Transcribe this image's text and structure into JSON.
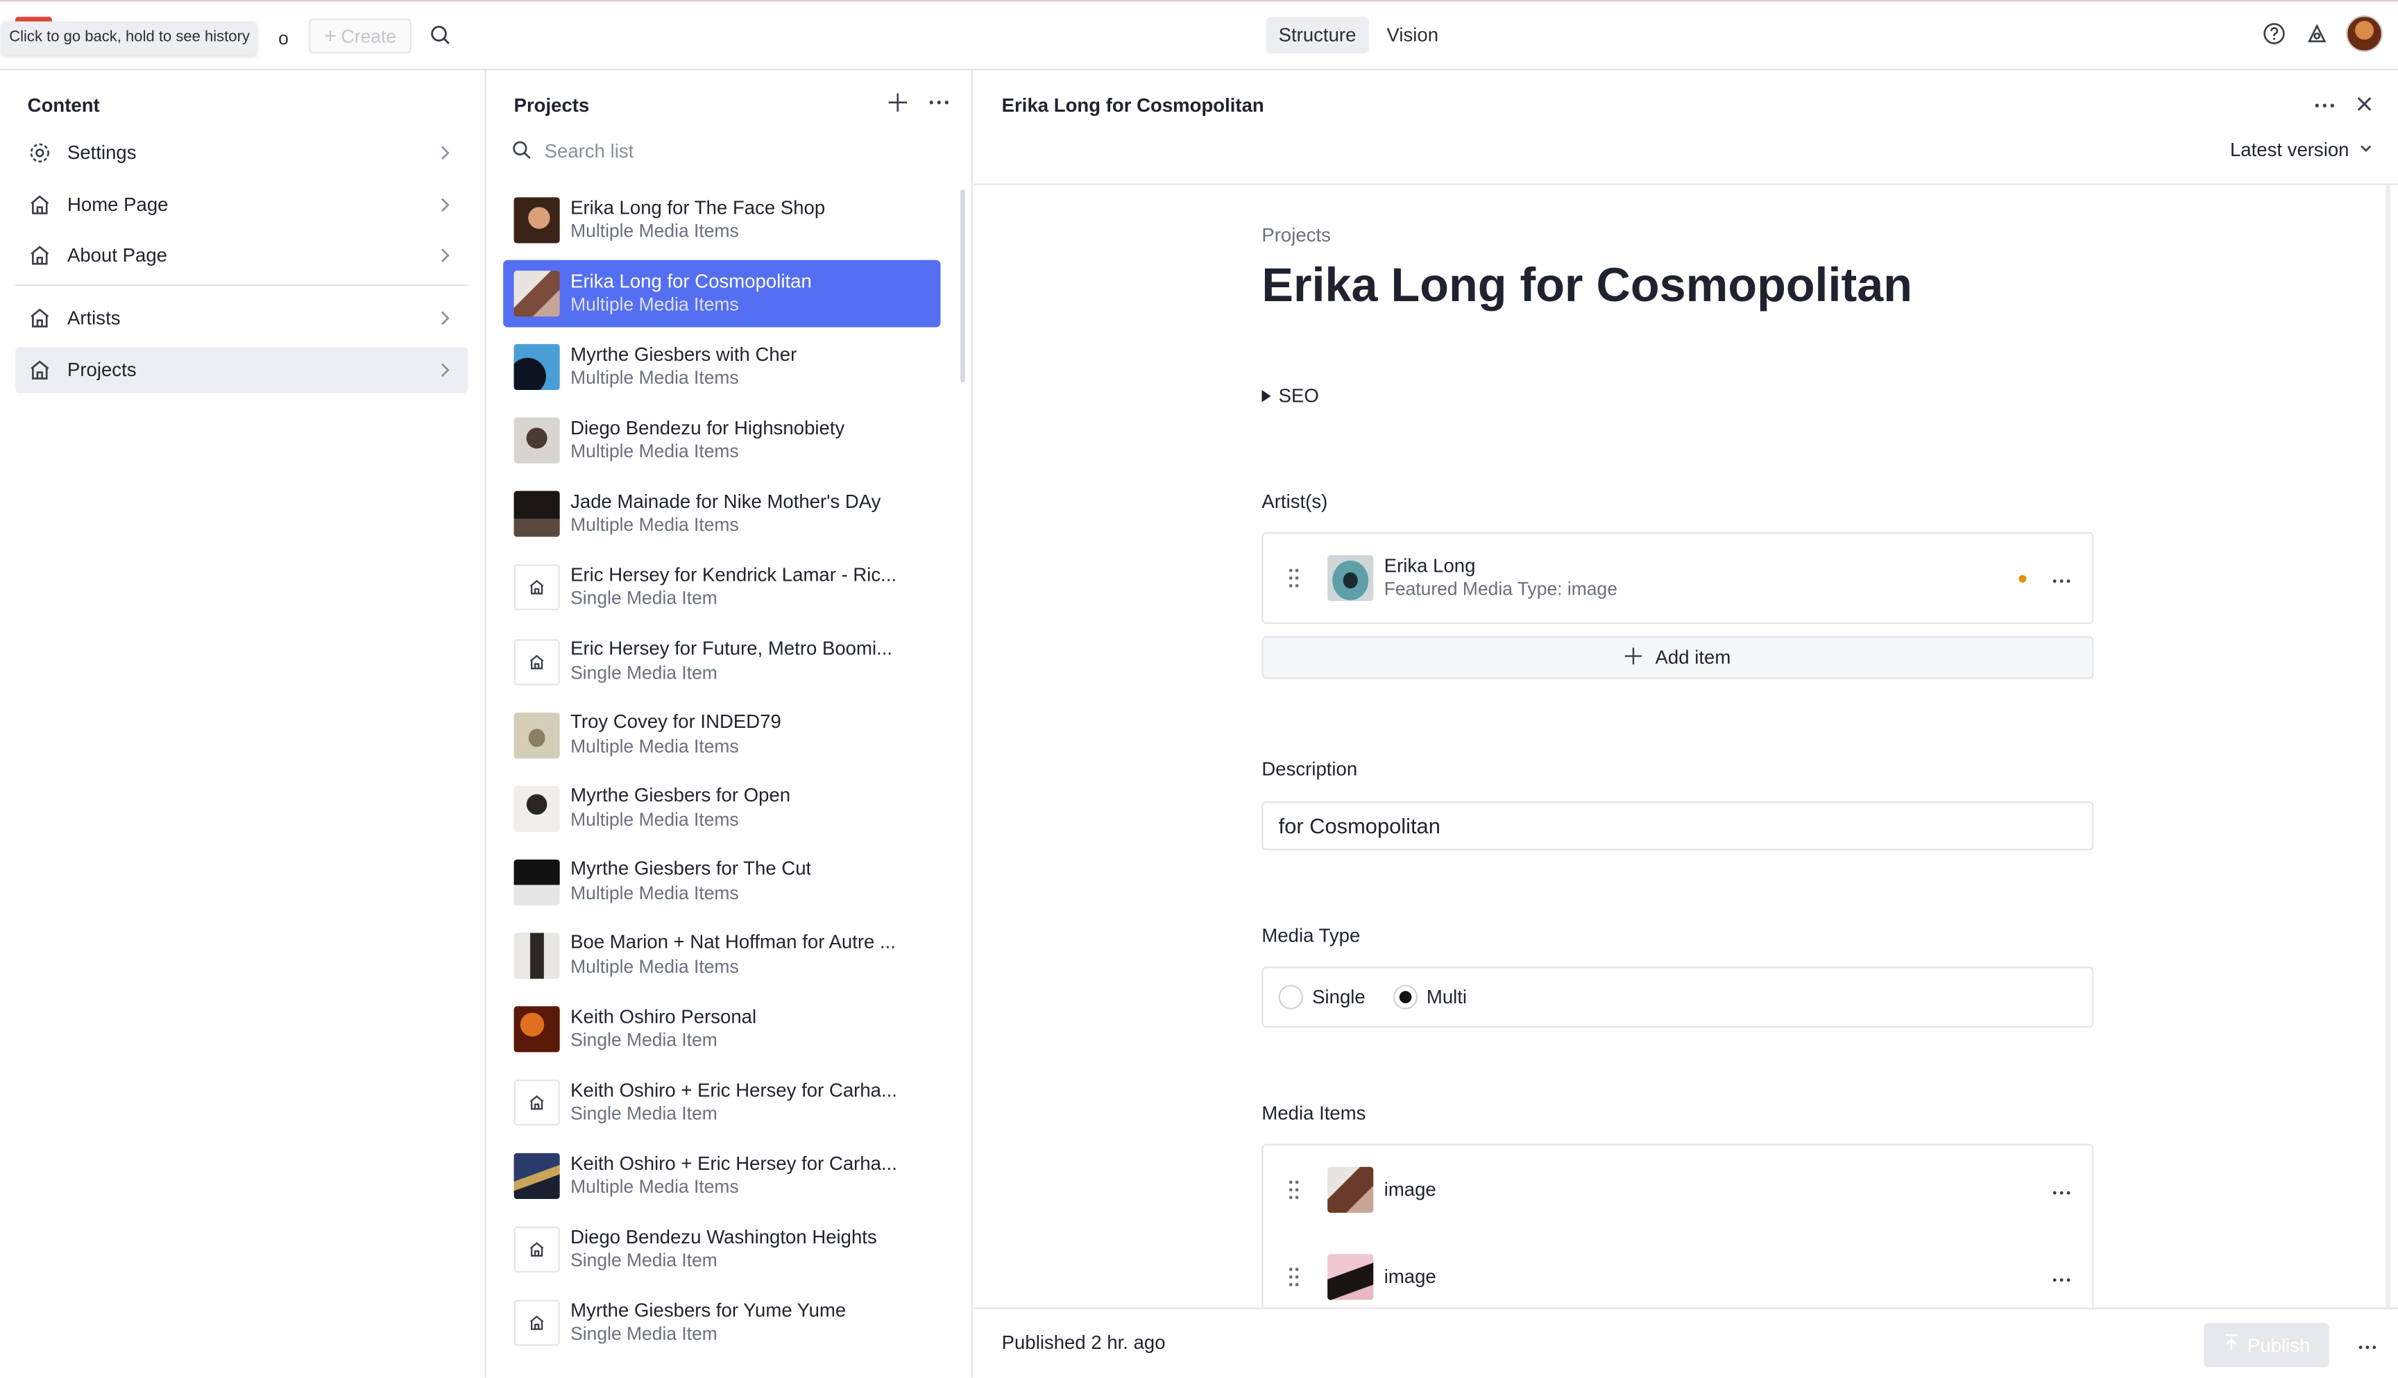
{
  "topbar": {
    "tooltip": "Click to go back, hold to see history",
    "tooltip_tail": "o",
    "create_label": "Create",
    "modes": [
      "Structure",
      "Vision"
    ],
    "active_mode": "Structure"
  },
  "content_pane": {
    "title": "Content",
    "items": [
      {
        "label": "Settings",
        "icon": "gear-icon"
      },
      {
        "label": "Home Page",
        "icon": "home-icon"
      },
      {
        "label": "About Page",
        "icon": "home-icon"
      },
      {
        "label": "Artists",
        "icon": "home-icon"
      },
      {
        "label": "Projects",
        "icon": "home-icon"
      }
    ],
    "active": "Projects"
  },
  "projects_pane": {
    "title": "Projects",
    "search_placeholder": "Search list",
    "items": [
      {
        "title": "Erika Long for The Face Shop",
        "subtitle": "Multiple Media Items"
      },
      {
        "title": "Erika Long for Cosmopolitan",
        "subtitle": "Multiple Media Items"
      },
      {
        "title": "Myrthe Giesbers with Cher",
        "subtitle": "Multiple Media Items"
      },
      {
        "title": "Diego Bendezu for Highsnobiety",
        "subtitle": "Multiple Media Items"
      },
      {
        "title": "Jade Mainade for Nike Mother's DAy",
        "subtitle": "Multiple Media Items"
      },
      {
        "title": "Eric Hersey for Kendrick Lamar - Ric...",
        "subtitle": "Single Media Item"
      },
      {
        "title": "Eric Hersey for Future, Metro Boomi...",
        "subtitle": "Single Media Item"
      },
      {
        "title": "Troy Covey for INDED79",
        "subtitle": "Multiple Media Items"
      },
      {
        "title": "Myrthe Giesbers for Open",
        "subtitle": "Multiple Media Items"
      },
      {
        "title": "Myrthe Giesbers for The Cut",
        "subtitle": "Multiple Media Items"
      },
      {
        "title": "Boe Marion + Nat Hoffman for Autre ...",
        "subtitle": "Multiple Media Items"
      },
      {
        "title": "Keith Oshiro Personal",
        "subtitle": "Single Media Item"
      },
      {
        "title": "Keith Oshiro + Eric Hersey for Carha...",
        "subtitle": "Single Media Item"
      },
      {
        "title": "Keith Oshiro + Eric Hersey for Carha...",
        "subtitle": "Multiple Media Items"
      },
      {
        "title": "Diego Bendezu Washington Heights",
        "subtitle": "Single Media Item"
      },
      {
        "title": "Myrthe Giesbers for Yume Yume",
        "subtitle": "Single Media Item"
      }
    ],
    "selected_index": 1
  },
  "document": {
    "header_title": "Erika Long for Cosmopolitan",
    "version_label": "Latest version",
    "breadcrumb": "Projects",
    "title": "Erika Long for Cosmopolitan",
    "seo_label": "SEO",
    "artists": {
      "label": "Artist(s)",
      "items": [
        {
          "title": "Erika Long",
          "subtitle": "Featured Media Type: image"
        }
      ],
      "add_label": "Add item"
    },
    "description": {
      "label": "Description",
      "value": "for Cosmopolitan"
    },
    "media_type": {
      "label": "Media Type",
      "options": [
        "Single",
        "Multi"
      ],
      "selected": "Multi"
    },
    "media_items": {
      "label": "Media Items",
      "items": [
        "image",
        "image"
      ]
    }
  },
  "footer": {
    "status": "Published 2 hr. ago",
    "publish_label": "Publish"
  },
  "colors": {
    "selection": "#556ff2",
    "logo": "#e0453b",
    "changed_dot": "#e0920c"
  }
}
